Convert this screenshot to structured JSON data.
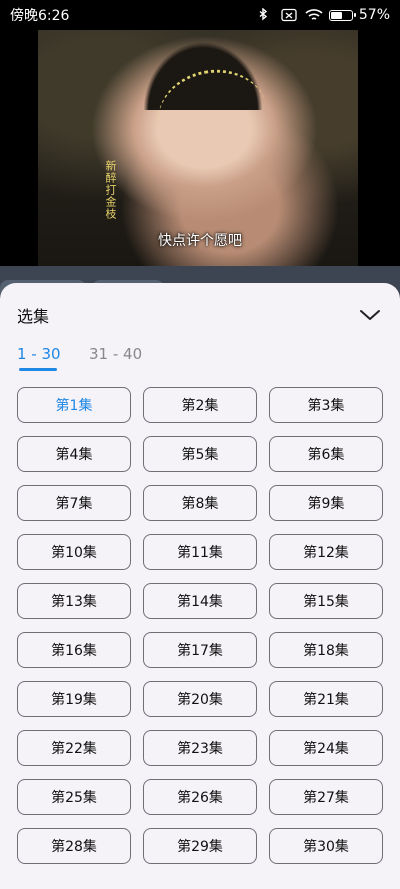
{
  "status_bar": {
    "time": "傍晚6:26",
    "battery": "57%",
    "battery_level": 0.57,
    "icons": [
      "bluetooth-icon",
      "sim-icon",
      "wifi-icon",
      "battery-icon"
    ]
  },
  "video": {
    "side_title": "新醉打金枝",
    "subtitle": "快点许个愿吧"
  },
  "sheet": {
    "title": "选集",
    "collapse_icon": "chevron-down-icon",
    "tabs": [
      {
        "label": "1 - 30",
        "active": true
      },
      {
        "label": "31 - 40",
        "active": false
      }
    ],
    "current_episode": "第1集",
    "episodes": [
      "第1集",
      "第2集",
      "第3集",
      "第4集",
      "第5集",
      "第6集",
      "第7集",
      "第8集",
      "第9集",
      "第10集",
      "第11集",
      "第12集",
      "第13集",
      "第14集",
      "第15集",
      "第16集",
      "第17集",
      "第18集",
      "第19集",
      "第20集",
      "第21集",
      "第22集",
      "第23集",
      "第24集",
      "第25集",
      "第26集",
      "第27集",
      "第28集",
      "第29集",
      "第30集"
    ]
  },
  "colors": {
    "accent": "#1e88e5",
    "sheet_bg": "#f5f2f8",
    "border": "#6f6f75"
  }
}
